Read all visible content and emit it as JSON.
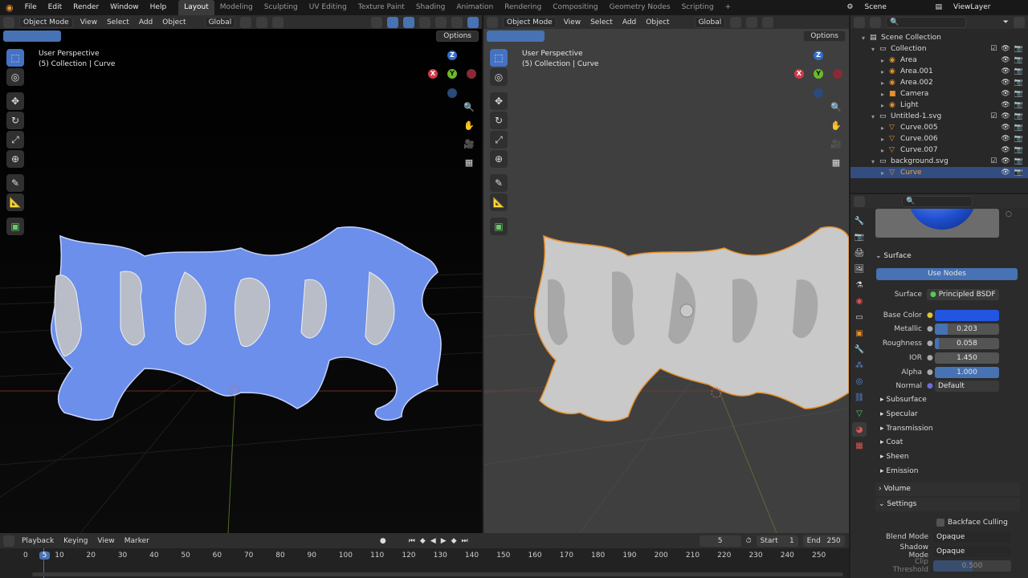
{
  "topbar": {
    "menus": [
      "File",
      "Edit",
      "Render",
      "Window",
      "Help"
    ],
    "workspaces": [
      "Layout",
      "Modeling",
      "Sculpting",
      "UV Editing",
      "Texture Paint",
      "Shading",
      "Animation",
      "Rendering",
      "Compositing",
      "Geometry Nodes",
      "Scripting"
    ],
    "add_tab": "+",
    "scene": "Scene",
    "view_layer": "ViewLayer"
  },
  "viewport_left": {
    "mode": "Object Mode",
    "menus": [
      "View",
      "Select",
      "Add",
      "Object"
    ],
    "orientation": "Global",
    "options": "Options",
    "perspective": "User Perspective",
    "collection": "(5) Collection | Curve",
    "gizmo": {
      "x": "X",
      "y": "Y",
      "z": "Z"
    }
  },
  "viewport_right": {
    "mode": "Object Mode",
    "menus": [
      "View",
      "Select",
      "Add",
      "Object"
    ],
    "orientation": "Global",
    "options": "Options",
    "perspective": "User Perspective",
    "collection": "(5) Collection | Curve",
    "gizmo": {
      "x": "X",
      "y": "Y",
      "z": "Z"
    }
  },
  "outliner": {
    "rows": [
      {
        "label": "Scene Collection",
        "depth": 0,
        "icon": "scene-collection-icon"
      },
      {
        "label": "Collection",
        "depth": 1,
        "icon": "collection-icon",
        "check": true
      },
      {
        "label": "Area",
        "depth": 2,
        "icon": "light-icon"
      },
      {
        "label": "Area.001",
        "depth": 2,
        "icon": "light-icon"
      },
      {
        "label": "Area.002",
        "depth": 2,
        "icon": "light-icon"
      },
      {
        "label": "Camera",
        "depth": 2,
        "icon": "camera-icon"
      },
      {
        "label": "Light",
        "depth": 2,
        "icon": "light-icon"
      },
      {
        "label": "Untitled-1.svg",
        "depth": 1,
        "icon": "collection-icon",
        "check": true
      },
      {
        "label": "Curve.005",
        "depth": 2,
        "icon": "curve-icon"
      },
      {
        "label": "Curve.006",
        "depth": 2,
        "icon": "curve-icon"
      },
      {
        "label": "Curve.007",
        "depth": 2,
        "icon": "curve-icon"
      },
      {
        "label": "background.svg",
        "depth": 1,
        "icon": "collection-icon",
        "check": true
      },
      {
        "label": "Curve",
        "depth": 2,
        "icon": "curve-icon",
        "selected": true
      }
    ]
  },
  "properties": {
    "surface_panel": "Surface",
    "use_nodes": "Use Nodes",
    "surface_label": "Surface",
    "surface_value": "Principled BSDF",
    "base_color_label": "Base Color",
    "base_color": "#2255e0",
    "metallic_label": "Metallic",
    "metallic": "0.203",
    "roughness_label": "Roughness",
    "roughness": "0.058",
    "ior_label": "IOR",
    "ior": "1.450",
    "alpha_label": "Alpha",
    "alpha": "1.000",
    "normal_label": "Normal",
    "normal": "Default",
    "subpanels": [
      "Subsurface",
      "Specular",
      "Transmission",
      "Coat",
      "Sheen",
      "Emission"
    ],
    "volume_panel": "Volume",
    "settings_panel": "Settings",
    "backface_culling": "Backface Culling",
    "blend_mode_label": "Blend Mode",
    "blend_mode": "Opaque",
    "shadow_mode_label": "Shadow Mode",
    "shadow_mode": "Opaque",
    "clip_threshold_label": "Clip Threshold",
    "clip_threshold": "0.500"
  },
  "timeline": {
    "menus": [
      "Playback",
      "Keying",
      "View",
      "Marker"
    ],
    "current_frame": "5",
    "start_label": "Start",
    "start": "1",
    "end_label": "End",
    "end": "250",
    "ticks": [
      "0",
      "5",
      "10",
      "20",
      "30",
      "40",
      "50",
      "60",
      "70",
      "80",
      "90",
      "100",
      "110",
      "120",
      "130",
      "140",
      "150",
      "160",
      "170",
      "180",
      "190",
      "200",
      "210",
      "220",
      "230",
      "240",
      "250"
    ]
  },
  "colors": {
    "accent": "#4772b3",
    "selected_outline": "#e8902a",
    "base_color": "#2255e0"
  }
}
